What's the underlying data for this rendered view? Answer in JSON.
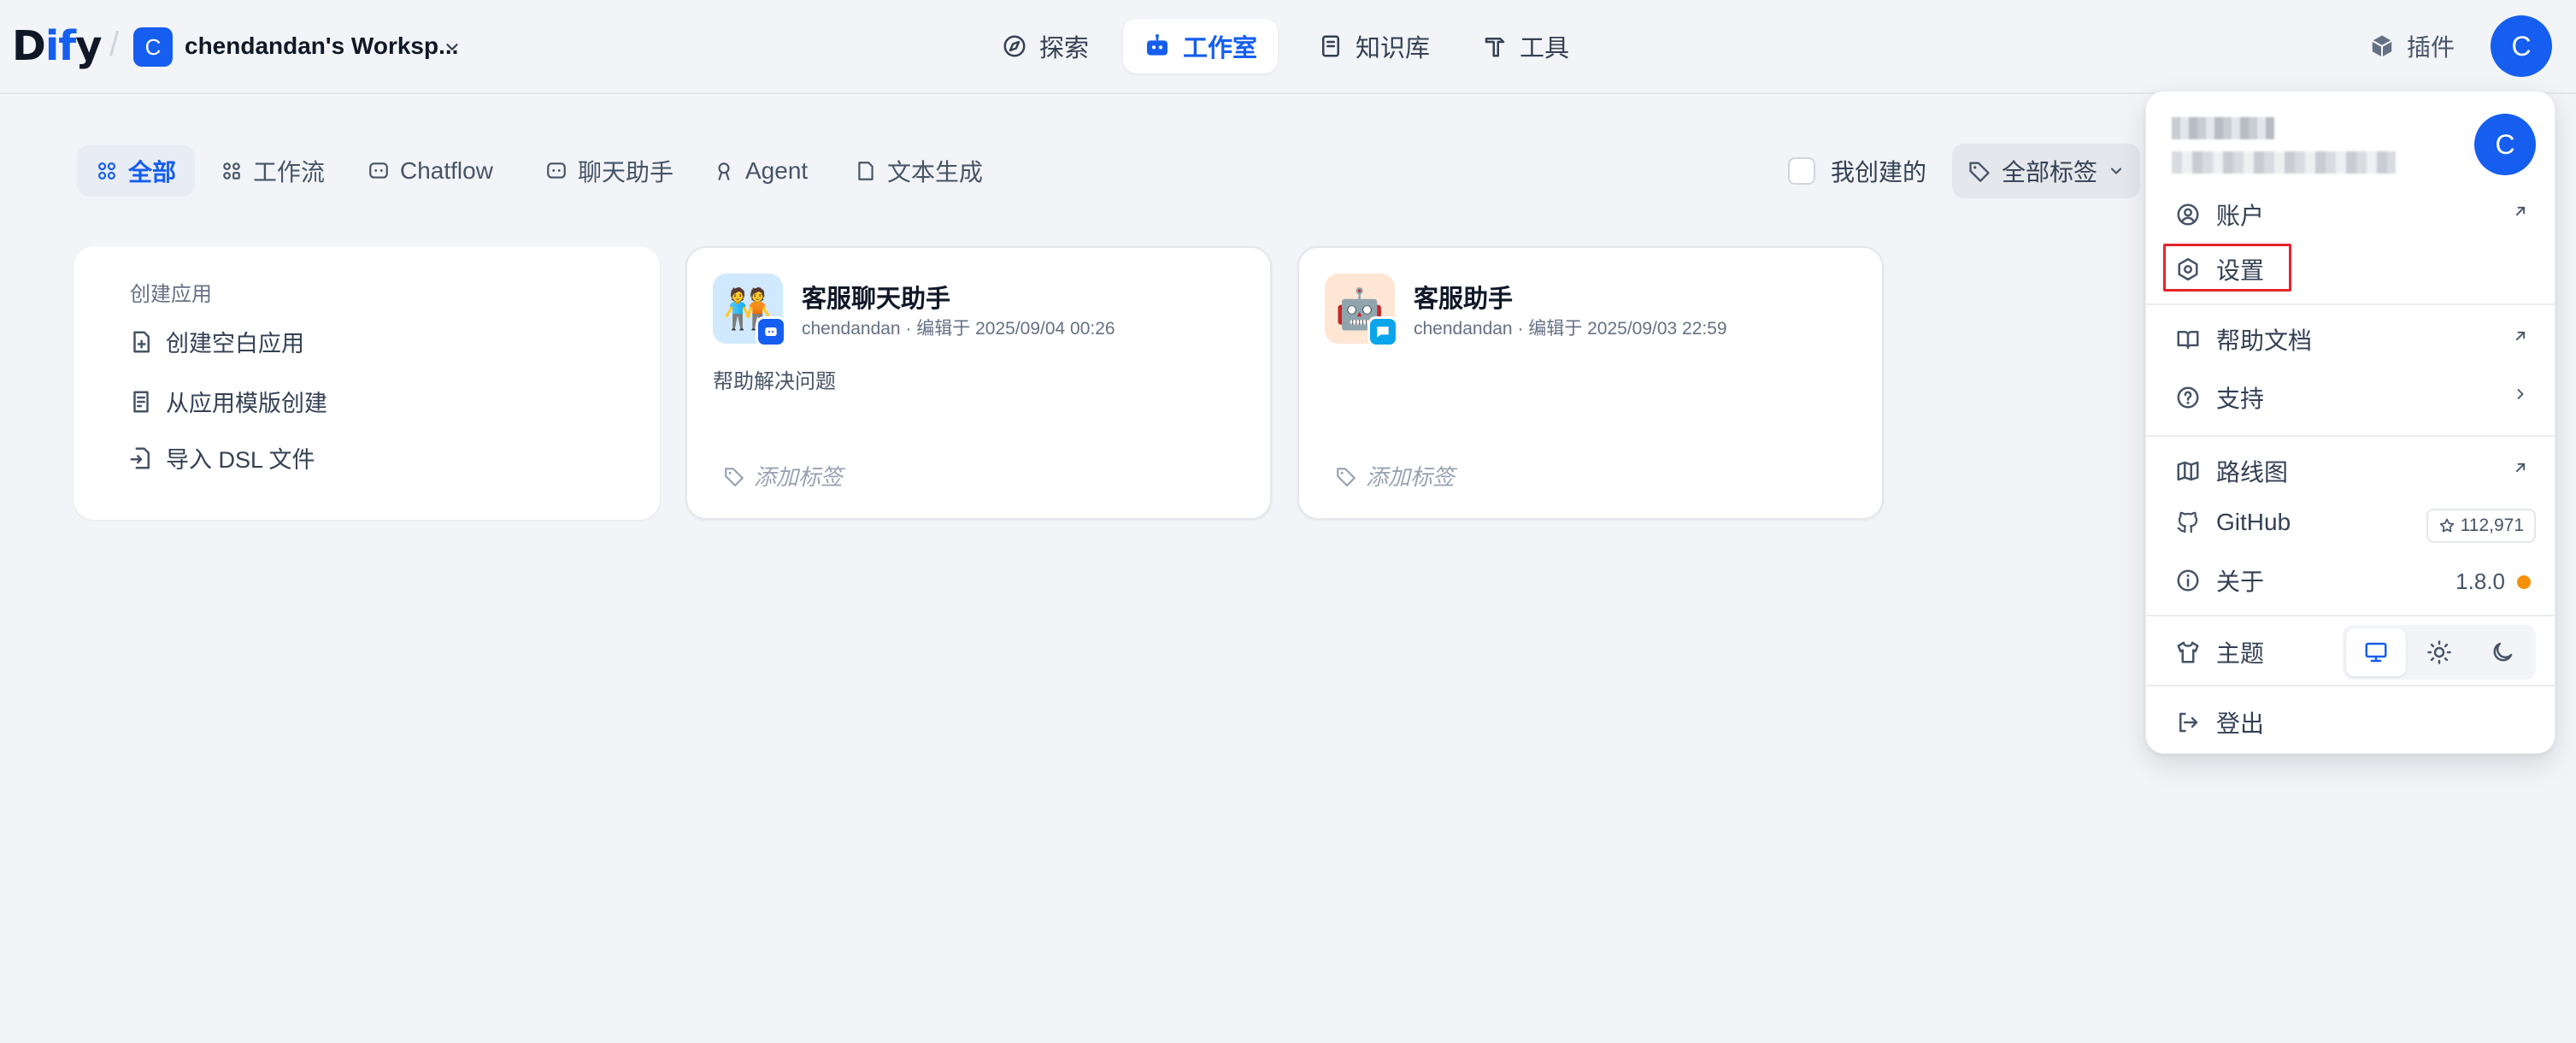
{
  "header": {
    "logo_main": "D",
    "logo_accent": "if",
    "logo_end": "y",
    "workspace_badge": "C",
    "workspace_name": "chendandan's Worksp...",
    "nav": {
      "explore": "探索",
      "studio": "工作室",
      "knowledge": "知识库",
      "tools": "工具"
    },
    "plugins": "插件",
    "avatar_letter": "C"
  },
  "filters": {
    "tabs": {
      "all": "全部",
      "workflow": "工作流",
      "chatflow": "Chatflow",
      "chatbot": "聊天助手",
      "agent": "Agent",
      "text": "文本生成"
    },
    "created_by_me": "我创建的",
    "all_tags": "全部标签"
  },
  "create_card": {
    "title": "创建应用",
    "blank": "创建空白应用",
    "template": "从应用模版创建",
    "import_dsl": "导入 DSL 文件"
  },
  "apps": [
    {
      "emoji": "🧑‍🤝‍🧑",
      "name": "客服聊天助手",
      "meta": "chendandan · 编辑于 2025/09/04 00:26",
      "description": "帮助解决问题",
      "add_tag": "添加标签"
    },
    {
      "emoji": "🤖",
      "name": "客服助手",
      "meta": "chendandan · 编辑于 2025/09/03 22:59",
      "description": "",
      "add_tag": "添加标签"
    }
  ],
  "menu": {
    "avatar_letter": "C",
    "account": "账户",
    "settings": "设置",
    "help_docs": "帮助文档",
    "support": "支持",
    "roadmap": "路线图",
    "github": "GitHub",
    "github_stars": "112,971",
    "about": "关于",
    "version": "1.8.0",
    "theme": "主题",
    "logout": "登出"
  },
  "colors": {
    "accent": "#155eef",
    "highlight_box": "#e5242b",
    "version_dot": "#f79009"
  }
}
